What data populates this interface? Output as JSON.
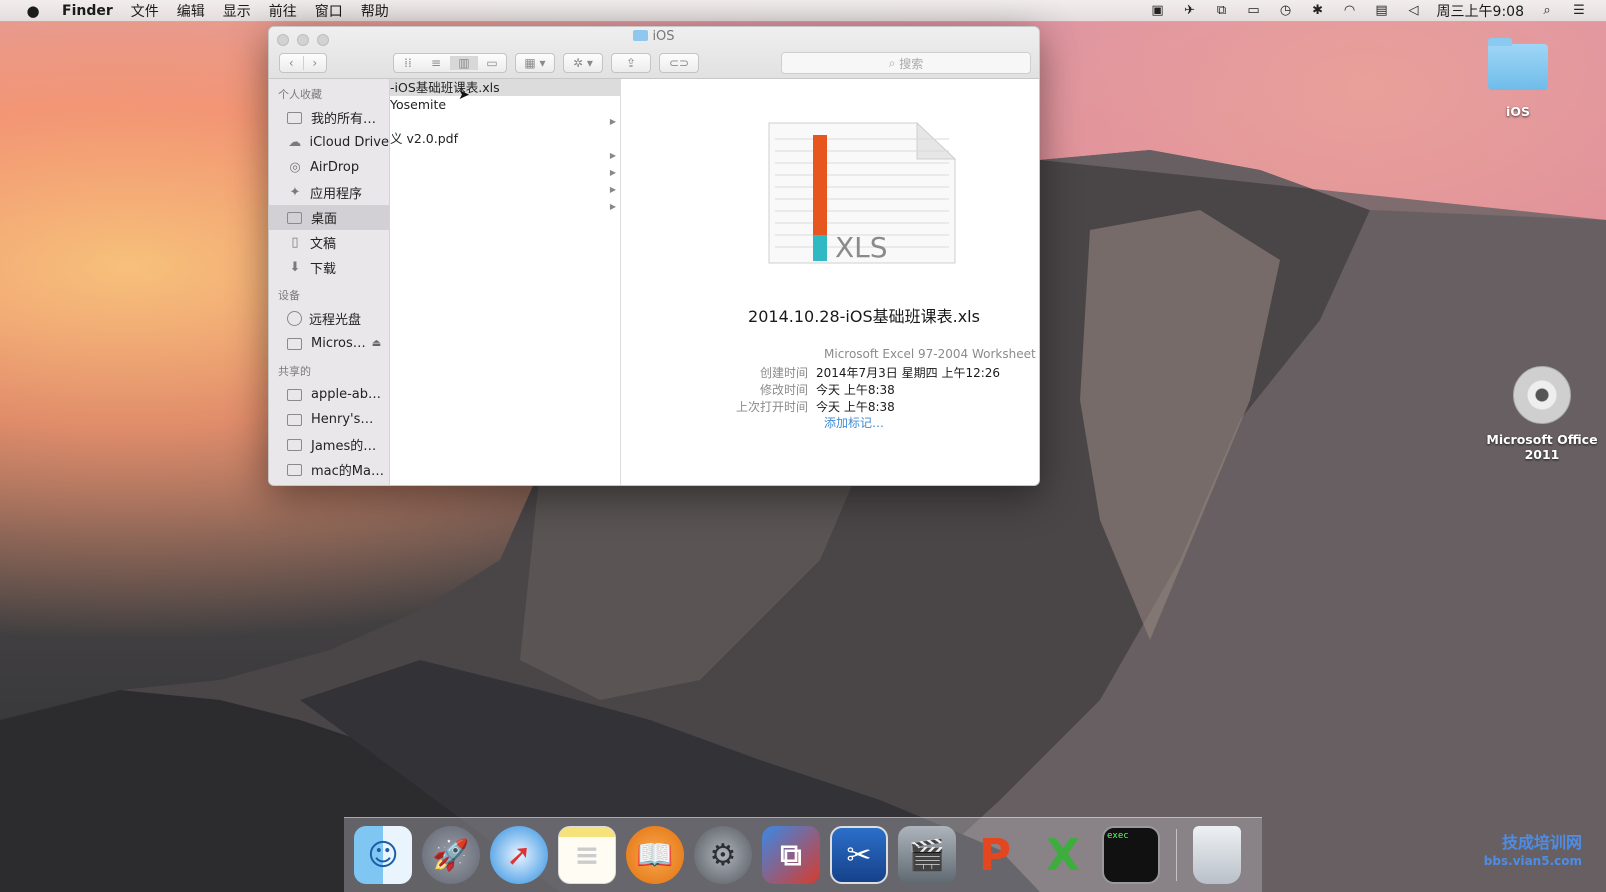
{
  "menubar": {
    "app_name": "Finder",
    "menus": [
      "文件",
      "编辑",
      "显示",
      "前往",
      "窗口",
      "帮助"
    ],
    "clock": "周三上午9:08"
  },
  "finder": {
    "title": "iOS",
    "search_placeholder": "搜索",
    "sidebar": {
      "favorites_label": "个人收藏",
      "favorites": [
        "我的所有…",
        "iCloud Drive",
        "AirDrop",
        "应用程序",
        "桌面",
        "文稿",
        "下载"
      ],
      "devices_label": "设备",
      "devices": [
        "远程光盘",
        "Micros…"
      ],
      "shared_label": "共享的",
      "shared": [
        "apple-ab…",
        "Henry's…",
        "James的…",
        "mac的Ma…"
      ]
    },
    "column": {
      "items": [
        "-iOS基础班课表.xls",
        "Yosemite",
        "",
        "义  v2.0.pdf",
        "",
        "",
        "",
        "",
        "",
        ""
      ]
    },
    "preview": {
      "icon_text": "XLS",
      "file_name": "2014.10.28-iOS基础班课表.xls",
      "kind": "Microsoft Excel 97-2004 Worksheet",
      "created_label": "创建时间",
      "created_value": "2014年7月3日 星期四 上午12:26",
      "modified_label": "修改时间",
      "modified_value": "今天 上午8:38",
      "opened_label": "上次打开时间",
      "opened_value": "今天 上午8:38",
      "add_tags": "添加标记…"
    }
  },
  "desktop": {
    "folder_label": "iOS",
    "disc_label_line1": "Microsoft Office",
    "disc_label_line2": "2011"
  },
  "dock": {
    "apps": [
      "finder-icon",
      "launchpad-icon",
      "safari-icon",
      "notes-icon",
      "ibooks-icon",
      "system-preferences-icon",
      "remote-desktop-icon",
      "screenshot-scissors-icon",
      "photo-booth-icon",
      "powerpoint-icon",
      "excel-icon",
      "terminal-icon",
      "trash-icon"
    ],
    "terminal_text": "exec"
  },
  "watermark": {
    "line1": "技成培训网",
    "line2": "bbs.vian5.com"
  }
}
